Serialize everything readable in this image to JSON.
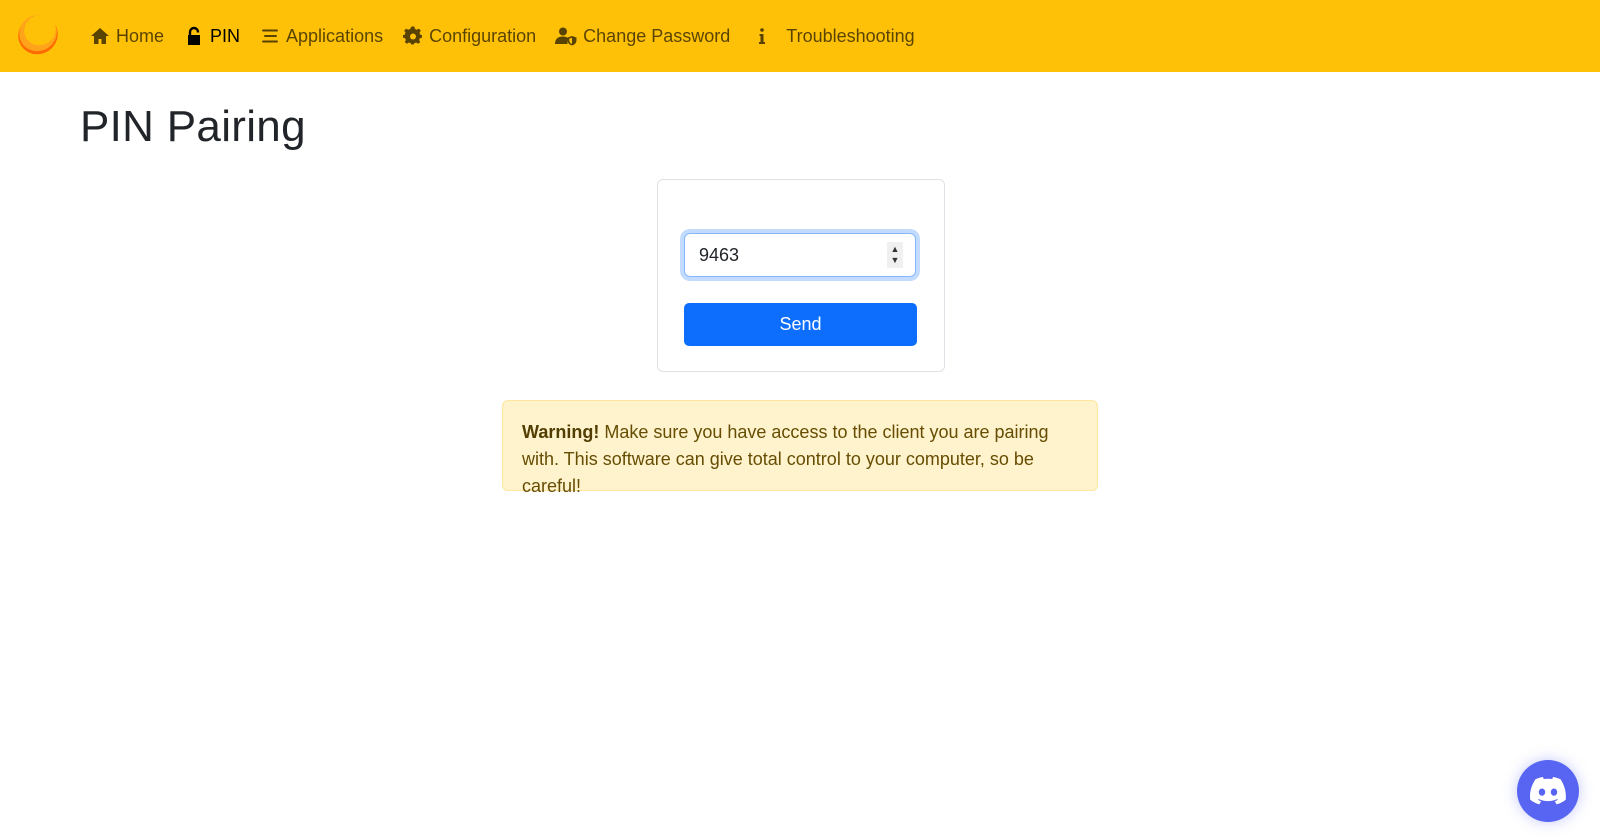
{
  "navbar": {
    "logo": "sunshine-logo",
    "items": [
      {
        "label": "Home",
        "icon": "home-icon",
        "active": false
      },
      {
        "label": "PIN",
        "icon": "unlock-icon",
        "active": true
      },
      {
        "label": "Applications",
        "icon": "list-icon",
        "active": false
      },
      {
        "label": "Configuration",
        "icon": "gear-icon",
        "active": false
      },
      {
        "label": "Change Password",
        "icon": "user-shield-icon",
        "active": false
      },
      {
        "label": "Troubleshooting",
        "icon": "info-icon",
        "active": false
      }
    ]
  },
  "page": {
    "title": "PIN Pairing"
  },
  "pin_form": {
    "pin_value": "9463",
    "send_label": "Send"
  },
  "alert": {
    "strong": "Warning!",
    "text": " Make sure you have access to the client you are pairing with. This software can give total control to your computer, so be careful!"
  },
  "discord": {
    "icon": "discord-icon"
  },
  "colors": {
    "navbar_bg": "#ffc107",
    "primary": "#0d6efd",
    "alert_bg": "#fff3cd",
    "alert_text": "#664d03",
    "discord": "#5865f2"
  }
}
